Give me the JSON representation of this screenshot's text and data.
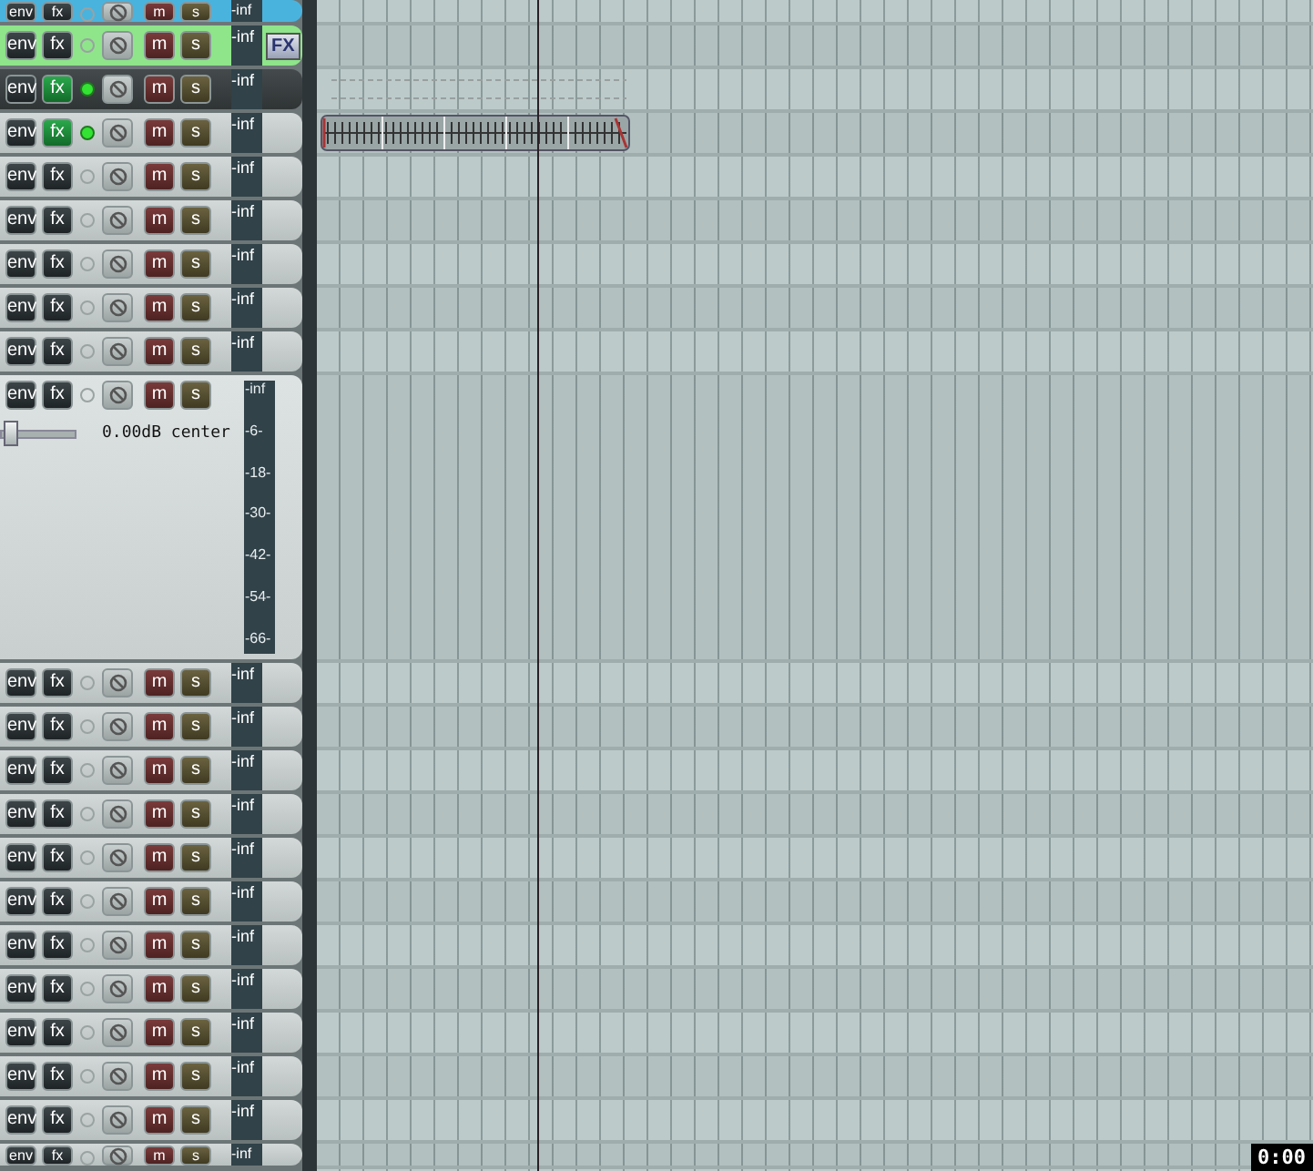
{
  "tracks": [
    {
      "kind": "normal",
      "color": "#4ab3dd",
      "selected": false,
      "fx_active": false,
      "armed": false,
      "has_envelope": false,
      "has_item": false,
      "labels": [
        "env",
        "fx",
        "m",
        "s"
      ],
      "meter": "-inf"
    },
    {
      "kind": "normal",
      "color": "#8ee58a",
      "selected": false,
      "fx_active": false,
      "armed": false,
      "has_envelope": false,
      "has_item": false,
      "labels": [
        "env",
        "fx",
        "m",
        "s"
      ],
      "meter": "-inf",
      "fx_badge": "FX"
    },
    {
      "kind": "normal",
      "selected": true,
      "fx_active": true,
      "armed": true,
      "has_envelope": true,
      "has_item": false,
      "labels": [
        "env",
        "fx",
        "m",
        "s"
      ],
      "meter": "-inf"
    },
    {
      "kind": "normal",
      "selected": false,
      "fx_active": true,
      "armed": true,
      "has_envelope": false,
      "has_item": true,
      "labels": [
        "env",
        "fx",
        "m",
        "s"
      ],
      "meter": "-inf"
    },
    {
      "kind": "normal",
      "selected": false,
      "fx_active": false,
      "armed": false,
      "has_envelope": false,
      "has_item": false,
      "labels": [
        "env",
        "fx",
        "m",
        "s"
      ],
      "meter": "-inf"
    },
    {
      "kind": "normal",
      "selected": false,
      "fx_active": false,
      "armed": false,
      "has_envelope": false,
      "has_item": false,
      "labels": [
        "env",
        "fx",
        "m",
        "s"
      ],
      "meter": "-inf"
    },
    {
      "kind": "normal",
      "selected": false,
      "fx_active": false,
      "armed": false,
      "has_envelope": false,
      "has_item": false,
      "labels": [
        "env",
        "fx",
        "m",
        "s"
      ],
      "meter": "-inf"
    },
    {
      "kind": "normal",
      "selected": false,
      "fx_active": false,
      "armed": false,
      "has_envelope": false,
      "has_item": false,
      "labels": [
        "env",
        "fx",
        "m",
        "s"
      ],
      "meter": "-inf"
    },
    {
      "kind": "normal",
      "selected": false,
      "fx_active": false,
      "armed": false,
      "has_envelope": false,
      "has_item": false,
      "labels": [
        "env",
        "fx",
        "m",
        "s"
      ],
      "meter": "-inf"
    },
    {
      "kind": "expanded",
      "selected": false,
      "fx_active": false,
      "armed": false,
      "has_envelope": false,
      "has_item": false,
      "labels": [
        "env",
        "fx",
        "m",
        "s"
      ],
      "volume": {
        "level": 0.15,
        "reading": "0.00dB center"
      },
      "meter_scale": [
        "-inf",
        "-6-",
        "-18-",
        "-30-",
        "-42-",
        "-54-",
        "-66-"
      ]
    },
    {
      "kind": "normal",
      "selected": false,
      "fx_active": false,
      "armed": false,
      "has_envelope": false,
      "has_item": false,
      "labels": [
        "env",
        "fx",
        "m",
        "s"
      ],
      "meter": "-inf"
    },
    {
      "kind": "normal",
      "selected": false,
      "fx_active": false,
      "armed": false,
      "has_envelope": false,
      "has_item": false,
      "labels": [
        "env",
        "fx",
        "m",
        "s"
      ],
      "meter": "-inf"
    },
    {
      "kind": "normal",
      "selected": false,
      "fx_active": false,
      "armed": false,
      "has_envelope": false,
      "has_item": false,
      "labels": [
        "env",
        "fx",
        "m",
        "s"
      ],
      "meter": "-inf"
    },
    {
      "kind": "normal",
      "selected": false,
      "fx_active": false,
      "armed": false,
      "has_envelope": false,
      "has_item": false,
      "labels": [
        "env",
        "fx",
        "m",
        "s"
      ],
      "meter": "-inf"
    },
    {
      "kind": "normal",
      "selected": false,
      "fx_active": false,
      "armed": false,
      "has_envelope": false,
      "has_item": false,
      "labels": [
        "env",
        "fx",
        "m",
        "s"
      ],
      "meter": "-inf"
    },
    {
      "kind": "normal",
      "selected": false,
      "fx_active": false,
      "armed": false,
      "has_envelope": false,
      "has_item": false,
      "labels": [
        "env",
        "fx",
        "m",
        "s"
      ],
      "meter": "-inf"
    },
    {
      "kind": "normal",
      "selected": false,
      "fx_active": false,
      "armed": false,
      "has_envelope": false,
      "has_item": false,
      "labels": [
        "env",
        "fx",
        "m",
        "s"
      ],
      "meter": "-inf"
    },
    {
      "kind": "normal",
      "selected": false,
      "fx_active": false,
      "armed": false,
      "has_envelope": false,
      "has_item": false,
      "labels": [
        "env",
        "fx",
        "m",
        "s"
      ],
      "meter": "-inf"
    },
    {
      "kind": "normal",
      "selected": false,
      "fx_active": false,
      "armed": false,
      "has_envelope": false,
      "has_item": false,
      "labels": [
        "env",
        "fx",
        "m",
        "s"
      ],
      "meter": "-inf"
    },
    {
      "kind": "normal",
      "selected": false,
      "fx_active": false,
      "armed": false,
      "has_envelope": false,
      "has_item": false,
      "labels": [
        "env",
        "fx",
        "m",
        "s"
      ],
      "meter": "-inf"
    },
    {
      "kind": "normal",
      "selected": false,
      "fx_active": false,
      "armed": false,
      "has_envelope": false,
      "has_item": false,
      "labels": [
        "env",
        "fx",
        "m",
        "s"
      ],
      "meter": "-inf"
    },
    {
      "kind": "normal",
      "selected": false,
      "fx_active": false,
      "armed": false,
      "has_envelope": false,
      "has_item": false,
      "labels": [
        "env",
        "fx",
        "m",
        "s"
      ],
      "meter": "-inf"
    }
  ],
  "arrange": {
    "time_display": "0:00"
  }
}
